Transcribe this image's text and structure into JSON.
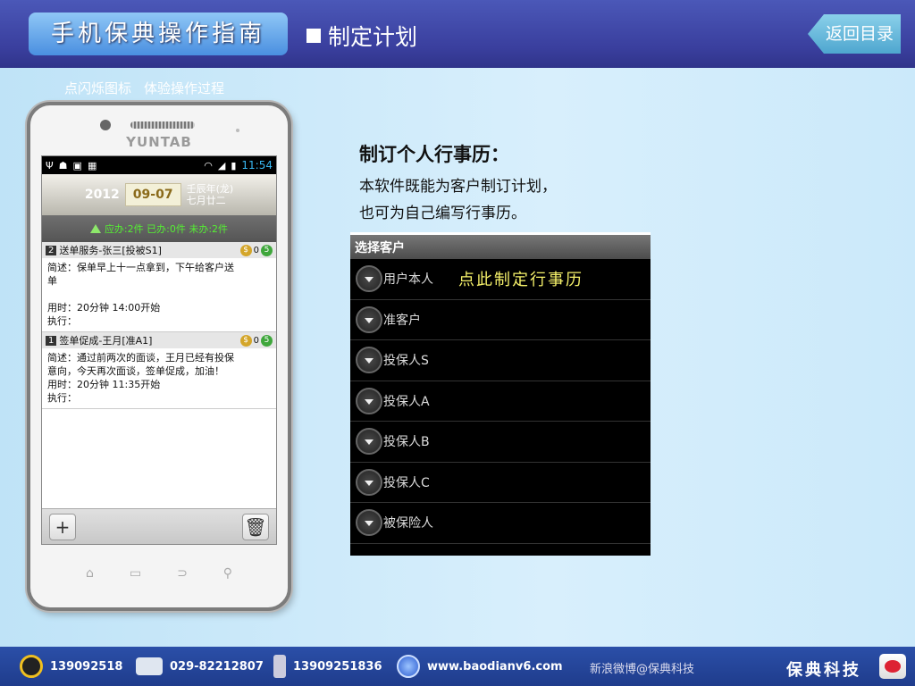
{
  "header": {
    "logo_text": "手机保典操作指南",
    "section_title": "制定计划",
    "back_label": "返回目录"
  },
  "tip": {
    "part1": "点闪烁图标",
    "part2": "体验操作过程"
  },
  "phone": {
    "brand": "YUNTAB",
    "status_time": "11:54",
    "year": "2012",
    "date": "09-07",
    "lunar_year": "壬辰年(龙)",
    "lunar_day": "七月廿二",
    "counts": "应办:2件  已办:0件  未办:2件",
    "tasks": [
      {
        "num": "2",
        "title": "送单服务-张三[投被S1]",
        "coin_count": "0",
        "coin_badge": "5",
        "lines": [
          "简述：保单早上十一点拿到，下午给客户送",
          "单",
          "",
          "用时：20分钟 14:00开始",
          "执行："
        ]
      },
      {
        "num": "1",
        "title": "签单促成-王月[准A1]",
        "coin_count": "0",
        "coin_badge": "5",
        "lines": [
          "简述：通过前两次的面谈，王月已经有投保",
          "意向，今天再次面谈，签单促成，加油！",
          "用时：20分钟 11:35开始",
          "执行："
        ]
      }
    ],
    "add_glyph": "+",
    "trash_glyph": "🗑"
  },
  "content": {
    "heading": "制订个人行事历：",
    "desc_line1": "本软件既能为客户制订计划，",
    "desc_line2": "也可为自己编写行事历。"
  },
  "panel": {
    "title": "选择客户",
    "items": [
      "用户本人",
      "准客户",
      "投保人S",
      "投保人A",
      "投保人B",
      "投保人C",
      "被保险人"
    ],
    "hint": "点此制定行事历"
  },
  "footer": {
    "qq": "139092518",
    "phone": "029-82212807",
    "mobile": "13909251836",
    "website": "www.baodianv6.com",
    "weibo": "新浪微博@保典科技",
    "company": "保典科技"
  },
  "colors": {
    "header_bg": "#3a3f9e",
    "footer_bg": "#1f3c8c",
    "hint_yellow": "#f5f06a",
    "count_green": "#55ee33"
  }
}
